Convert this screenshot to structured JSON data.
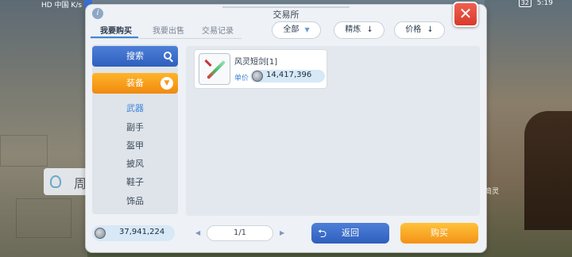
{
  "status_bar": {
    "left": "HD 中国 K/s",
    "battery": "32",
    "time": "5:19"
  },
  "background": {
    "chip_text": "周",
    "right_text": "简灵"
  },
  "dialog": {
    "title": "交易所",
    "close_label": "✕",
    "info_label": "i",
    "tabs": [
      {
        "label": "我要购买",
        "active": true
      },
      {
        "label": "我要出售",
        "active": false
      },
      {
        "label": "交易记录",
        "active": false
      }
    ],
    "filters": {
      "all": "全部",
      "refine": "精炼",
      "price": "价格",
      "sort_arrow": "↓",
      "all_chevron": "▼"
    },
    "sidebar": {
      "search_label": "搜索",
      "category_label": "装备",
      "items": [
        {
          "label": "武器",
          "active": true
        },
        {
          "label": "副手",
          "active": false
        },
        {
          "label": "盔甲",
          "active": false
        },
        {
          "label": "披风",
          "active": false
        },
        {
          "label": "鞋子",
          "active": false
        },
        {
          "label": "饰品",
          "active": false
        }
      ]
    },
    "listings": [
      {
        "name": "风灵短剑[1]",
        "unit_price_label": "单价",
        "price": "14,417,396",
        "icon": "short-sword-icon"
      }
    ],
    "footer": {
      "balance": "37,941,224",
      "page": "1/1",
      "back_label": "返回",
      "buy_label": "购买",
      "prev_arrow": "◀",
      "next_arrow": "▶",
      "back_icon": "⮌"
    }
  },
  "colors": {
    "accent_blue": "#3f86d9",
    "accent_orange": "#f39217",
    "close_red": "#d83a2c"
  }
}
